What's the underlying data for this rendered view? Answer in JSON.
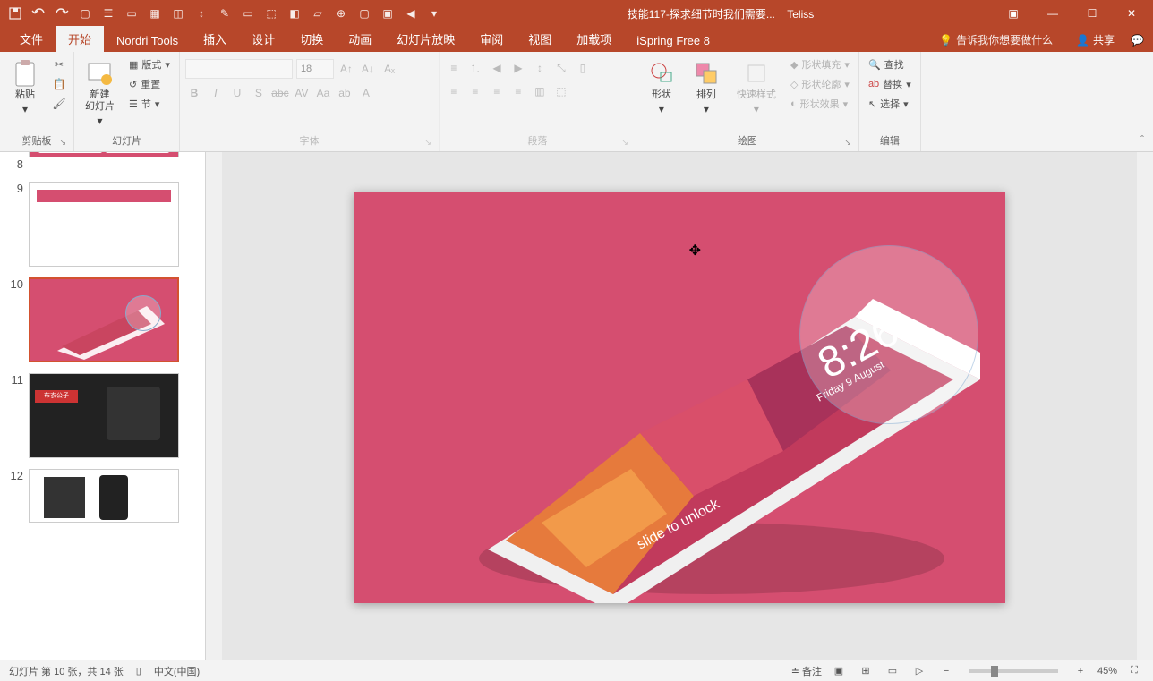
{
  "titleBar": {
    "docTitle": "技能117-探求细节时我们需要...",
    "userName": "Teliss"
  },
  "tabs": [
    "文件",
    "开始",
    "Nordri Tools",
    "插入",
    "设计",
    "切换",
    "动画",
    "幻灯片放映",
    "审阅",
    "视图",
    "加载项",
    "iSpring Free 8"
  ],
  "activeTab": 1,
  "tellMe": "告诉我你想要做什么",
  "share": "共享",
  "ribbon": {
    "clipboard": {
      "label": "剪贴板",
      "paste": "粘贴"
    },
    "slides": {
      "label": "幻灯片",
      "newSlide": "新建\n幻灯片",
      "layout": "版式",
      "reset": "重置",
      "section": "节"
    },
    "font": {
      "label": "字体",
      "size": "18"
    },
    "paragraph": {
      "label": "段落"
    },
    "drawing": {
      "label": "绘图",
      "shapes": "形状",
      "arrange": "排列",
      "quickStyles": "快速样式",
      "fill": "形状填充",
      "outline": "形状轮廓",
      "effects": "形状效果"
    },
    "editing": {
      "label": "编辑",
      "find": "查找",
      "replace": "替换",
      "select": "选择"
    }
  },
  "slides_panel": [
    {
      "num": "8"
    },
    {
      "num": "9"
    },
    {
      "num": "10",
      "selected": true
    },
    {
      "num": "11"
    },
    {
      "num": "12"
    }
  ],
  "slideContent": {
    "time": "8:26",
    "date": "Friday 9 August",
    "unlock": "slide to unlock"
  },
  "statusBar": {
    "slideInfo": "幻灯片 第 10 张，共 14 张",
    "language": "中文(中国)",
    "notes": "备注",
    "zoom": "45%"
  }
}
